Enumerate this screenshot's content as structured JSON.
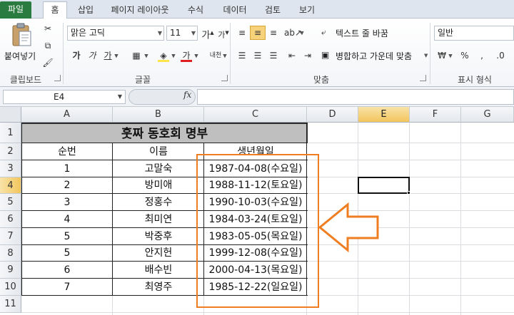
{
  "tabs": [
    {
      "label": "파일"
    },
    {
      "label": "홈"
    },
    {
      "label": "삽입"
    },
    {
      "label": "페이지 레이아웃"
    },
    {
      "label": "수식"
    },
    {
      "label": "데이터"
    },
    {
      "label": "검토"
    },
    {
      "label": "보기"
    }
  ],
  "ribbon": {
    "clipboard": {
      "paste_label": "붙여넣기",
      "group_label": "클립보드"
    },
    "font": {
      "font_name": "맑은 고딕",
      "font_size": "11",
      "group_label": "글꼴",
      "grow_label": "가",
      "shrink_label": "가",
      "bold": "가",
      "italic": "가",
      "underline": "가",
      "font_color_glyph": "가",
      "phonetic_glyph": "내천"
    },
    "alignment": {
      "wrap_text": "텍스트 줄 바꿈",
      "merge_center": "병합하고 가운데 맞춤",
      "group_label": "맞춤"
    },
    "number": {
      "format": "일반",
      "group_label": "표시 형식",
      "percent": "%",
      "comma": ","
    }
  },
  "formula_bar": {
    "name_box": "E4",
    "fx": "fx",
    "formula": ""
  },
  "columns": [
    "A",
    "B",
    "C",
    "D",
    "E",
    "F",
    "G"
  ],
  "rows": [
    "1",
    "2",
    "3",
    "4",
    "5",
    "6",
    "7",
    "8",
    "9",
    "10",
    "11"
  ],
  "selected": {
    "column": "E",
    "row": "4",
    "cell": "E4"
  },
  "sheet": {
    "title": "훗짜 동호회 명부",
    "headers": [
      "순번",
      "이름",
      "생년월일"
    ],
    "records": [
      {
        "no": "1",
        "name": "고말숙",
        "birth": "1987-04-08(수요일)"
      },
      {
        "no": "2",
        "name": "방미애",
        "birth": "1988-11-12(토요일)"
      },
      {
        "no": "3",
        "name": "정홍수",
        "birth": "1990-10-03(수요일)"
      },
      {
        "no": "4",
        "name": "최미연",
        "birth": "1984-03-24(토요일)"
      },
      {
        "no": "5",
        "name": "박중후",
        "birth": "1983-05-05(목요일)"
      },
      {
        "no": "5",
        "name": "안지헌",
        "birth": "1999-12-08(수요일)"
      },
      {
        "no": "6",
        "name": "배수빈",
        "birth": "2000-04-13(목요일)"
      },
      {
        "no": "7",
        "name": "최영주",
        "birth": "1985-12-22(일요일)"
      }
    ]
  },
  "annotation": {
    "color": "#ef7d22"
  },
  "colors": {
    "file_tab": "#2a7b3f",
    "selected_header": "#f2c55c",
    "title_fill": "#bfbfbf"
  }
}
